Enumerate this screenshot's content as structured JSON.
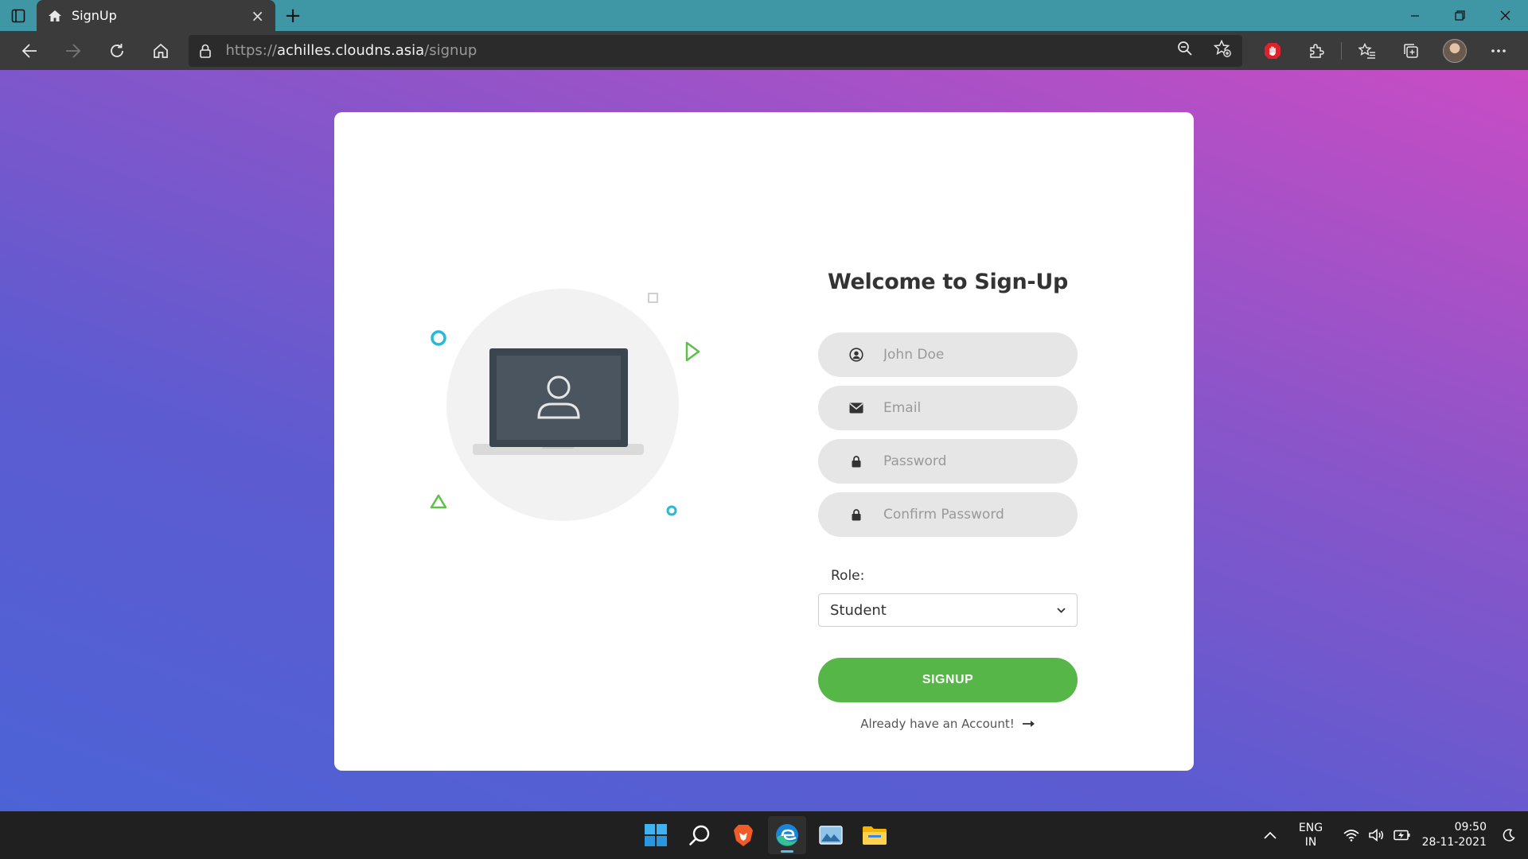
{
  "browser": {
    "tab_title": "SignUp",
    "url_scheme": "https://",
    "url_host": "achilles.cloudns.asia",
    "url_path": "/signup",
    "accent_color": "#3f97a6"
  },
  "page": {
    "title": "Welcome to Sign-Up",
    "fields": {
      "name_placeholder": "John Doe",
      "email_placeholder": "Email",
      "password_placeholder": "Password",
      "confirm_placeholder": "Confirm Password"
    },
    "role_label": "Role:",
    "role_selected": "Student",
    "signup_label": "SIGNUP",
    "already_label": "Already have an Account!",
    "colors": {
      "background_from": "#c94cc4",
      "background_to": "#4c63d6",
      "signup_button": "#56b748"
    }
  },
  "taskbar": {
    "apps": [
      "start-icon",
      "search-icon",
      "brave-icon",
      "edge-icon",
      "photos-icon",
      "file-explorer-icon"
    ],
    "language_line1": "ENG",
    "language_line2": "IN",
    "time": "09:50",
    "date": "28-11-2021"
  }
}
